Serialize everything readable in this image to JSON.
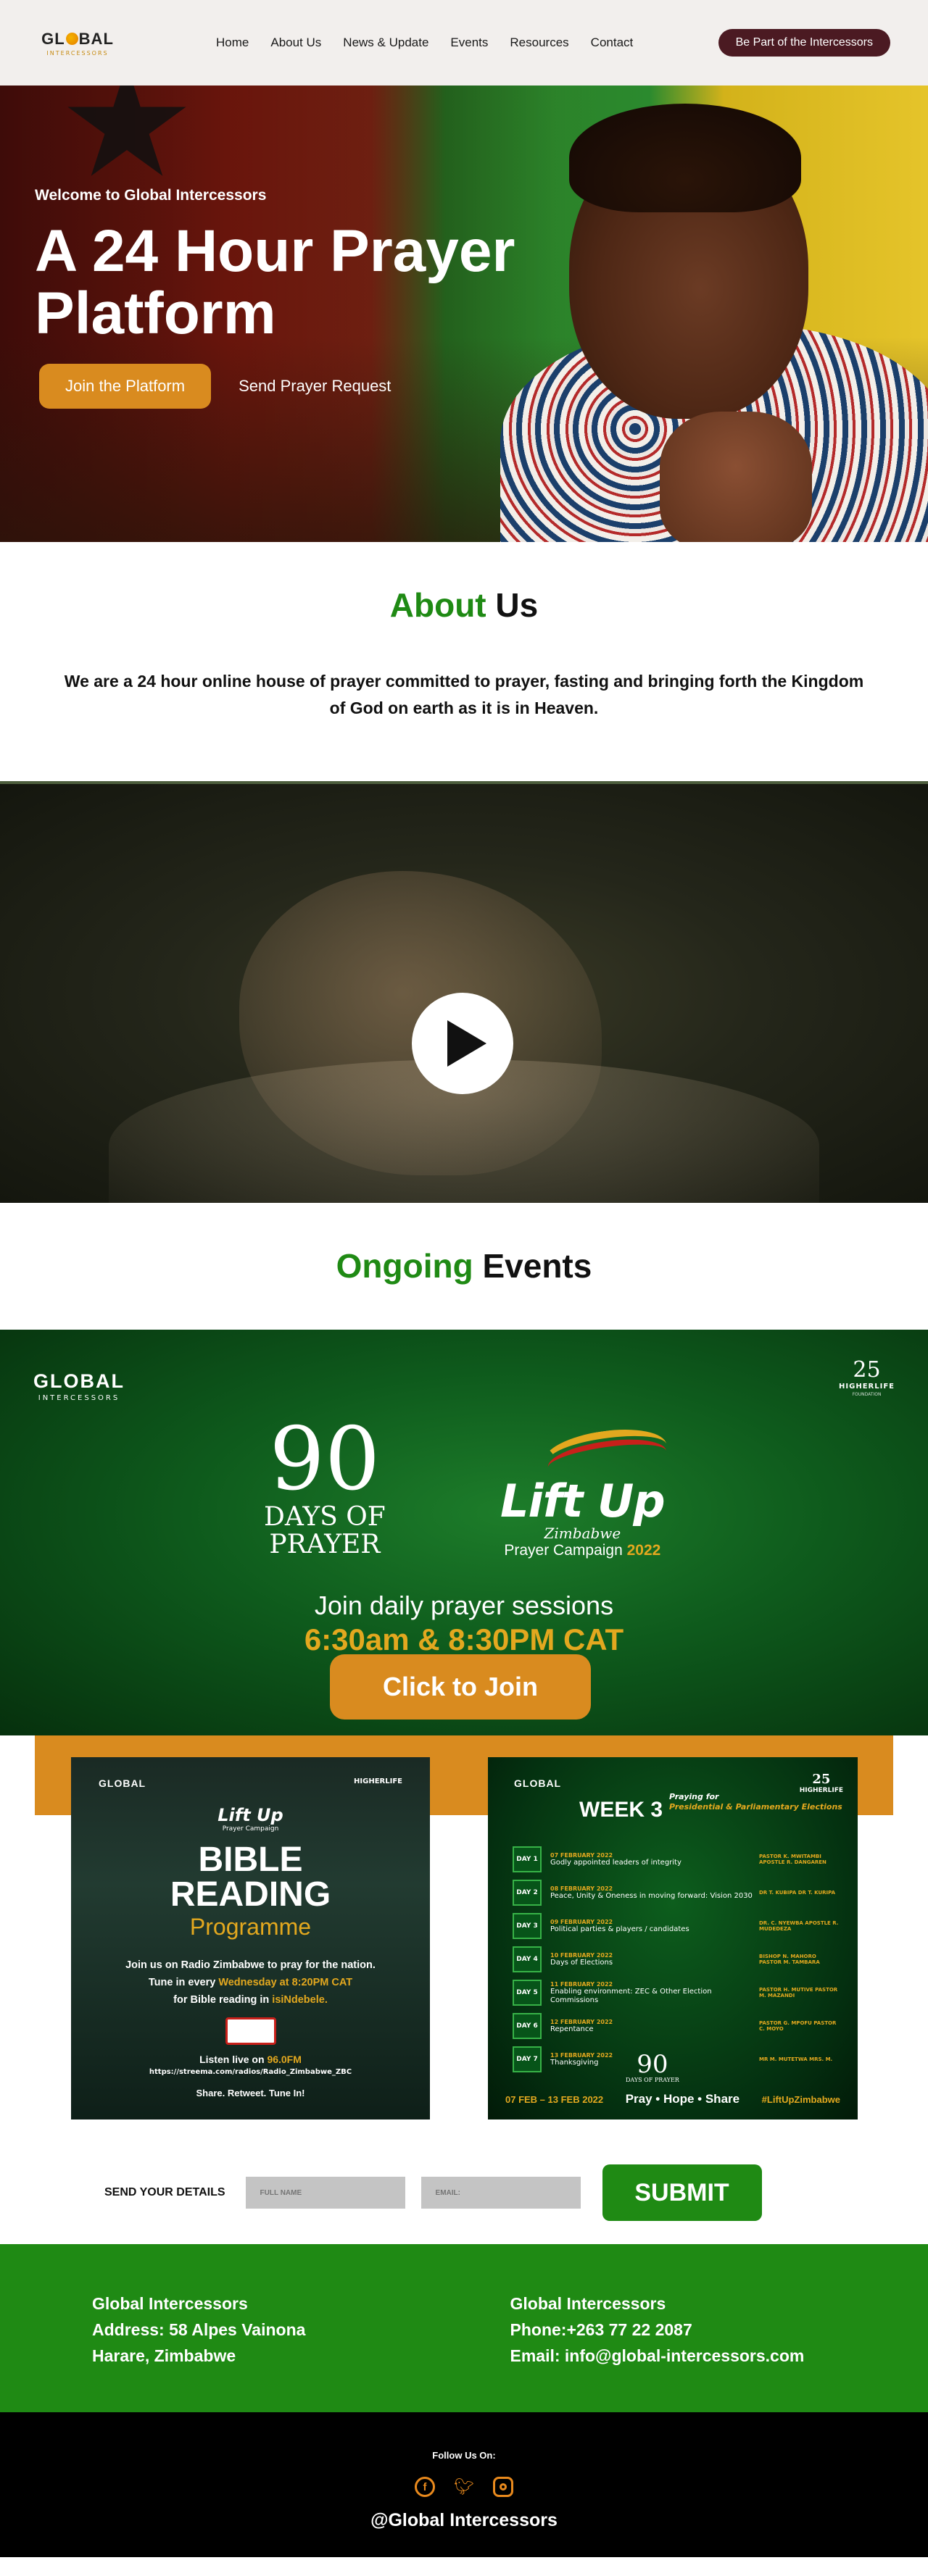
{
  "nav": {
    "logo_text": "GL BAL",
    "logo_sub": "INTERCESSORS",
    "items": [
      "Home",
      "About Us",
      "News & Update",
      "Events",
      "Resources",
      "Contact"
    ],
    "cta": "Be Part of the Intercessors"
  },
  "hero": {
    "welcome": "Welcome to Global Intercessors",
    "title": "A 24 Hour Prayer Platform",
    "join_button": "Join the Platform",
    "request_button": "Send Prayer Request"
  },
  "about": {
    "title_accent": "About",
    "title_rest": "Us",
    "text": "We are a 24 hour online house of prayer committed to prayer, fasting and bringing forth the Kingdom of God on earth as it is in Heaven."
  },
  "video": {
    "play_icon": "play-icon"
  },
  "events": {
    "title_accent": "Ongoing",
    "title_rest": "Events",
    "banner": {
      "logo": "GLOBAL",
      "logo_sub": "INTERCESSORS",
      "hlf_number": "25",
      "hlf_name": "HIGHERLIFE",
      "hlf_sub": "FOUNDATION",
      "days_number": "90",
      "days_line1": "DAYS OF",
      "days_line2": "PRAYER",
      "liftup": "Lift Up",
      "liftup_country": "Zimbabwe",
      "campaign": "Prayer Campaign",
      "campaign_year": "2022",
      "join_text": "Join daily prayer sessions",
      "times": "6:30am & 8:30PM CAT",
      "click_button": "Click to Join"
    },
    "poster_a": {
      "logo": "GLOBAL",
      "hlf": "HIGHERLIFE",
      "liftup": "Lift Up",
      "liftup_sub": "Prayer Campaign",
      "title1": "BIBLE",
      "title2": "READING",
      "programme": "Programme",
      "line1": "Join us on Radio Zimbabwe to pray for the nation.",
      "line2a": "Tune in every ",
      "line2b": "Wednesday at 8:20PM CAT",
      "line3a": "for Bible reading in ",
      "line3b": "isiNdebele.",
      "listen_a": "Listen live on ",
      "listen_b": "96.0FM",
      "url": "https://streema.com/radios/Radio_Zimbabwe_ZBC",
      "share": "Share. Retweet. Tune In!"
    },
    "poster_b": {
      "logo": "GLOBAL",
      "week": "WEEK 3",
      "theme_a": "Praying for",
      "theme_b": "Presidential & Parliamentary Elections",
      "hlf_number": "25",
      "hlf_name": "HIGHERLIFE",
      "days": [
        {
          "day": "DAY 1",
          "date": "07 FEBRUARY 2022",
          "topic": "Godly appointed leaders of integrity",
          "pastor": "PASTOR K. MWITAMBI APOSTLE R. DANGAREN"
        },
        {
          "day": "DAY 2",
          "date": "08 FEBRUARY 2022",
          "topic": "Peace, Unity & Oneness in moving forward: Vision 2030",
          "pastor": "DR T. KUBIPA DR T. KURIPA"
        },
        {
          "day": "DAY 3",
          "date": "09 FEBRUARY 2022",
          "topic": "Political parties & players / candidates",
          "pastor": "DR. C. NYEWBA APOSTLE R. MUDEDEZA"
        },
        {
          "day": "DAY 4",
          "date": "10 FEBRUARY 2022",
          "topic": "Days of Elections",
          "pastor": "BISHOP N. MAHORO PASTOR M. TAMBARA"
        },
        {
          "day": "DAY 5",
          "date": "11 FEBRUARY 2022",
          "topic": "Enabling environment: ZEC & Other Election Commissions",
          "pastor": "PASTOR H. MUTIVE PASTOR M. MAZANDI"
        },
        {
          "day": "DAY 6",
          "date": "12 FEBRUARY 2022",
          "topic": "Repentance",
          "pastor": "PASTOR G. MPOFU PASTOR C. MOYO"
        },
        {
          "day": "DAY 7",
          "date": "13 FEBRUARY 2022",
          "topic": "Thanksgiving",
          "pastor": "MR M. MUTETWA MRS. M."
        }
      ],
      "days_number": "90",
      "days_label": "DAYS OF PRAYER",
      "footer_dates": "07 FEB – 13 FEB 2022",
      "footer_motto": "Pray • Hope • Share",
      "footer_tag": "#LiftUpZimbabwe"
    }
  },
  "form": {
    "label": "SEND YOUR DETAILS",
    "name_placeholder": "FULL NAME",
    "email_placeholder": "EMAIL:",
    "submit": "SUBMIT"
  },
  "contact": {
    "left": [
      "Global Intercessors",
      "Address: 58 Alpes Vainona",
      "Harare, Zimbabwe"
    ],
    "right": [
      "Global Intercessors",
      "Phone:+263 77 22 2087",
      "Email: info@global-intercessors.com"
    ]
  },
  "footer": {
    "follow": "Follow Us On:",
    "social": [
      "facebook-icon",
      "twitter-icon",
      "instagram-icon"
    ],
    "handle": "@Global Intercessors"
  },
  "colors": {
    "brand_green": "#1f8a14",
    "accent_orange": "#d98b1f",
    "cta_maroon": "#4b1a22"
  }
}
